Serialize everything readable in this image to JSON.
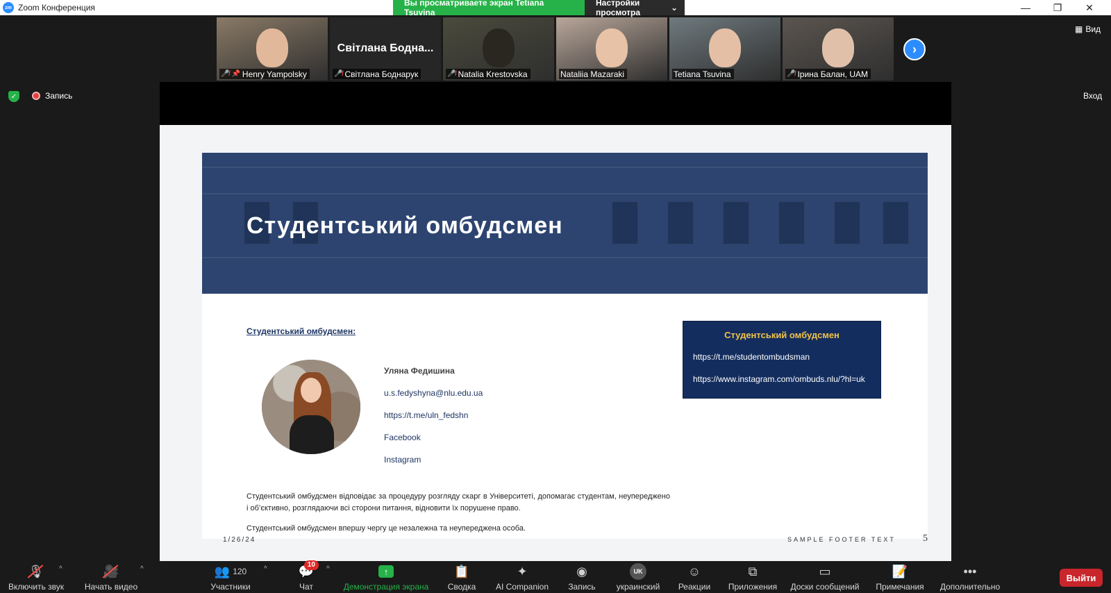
{
  "window": {
    "app_icon_text": "zm",
    "title": "Zoom Конференция",
    "share_notice": "Вы просматриваете экран Tetiana Tsuvina",
    "view_options": "Настройки просмотра",
    "minimize": "—",
    "restore": "❐",
    "close": "✕"
  },
  "participants": [
    {
      "name": "Henry Yampolsky",
      "muted": true,
      "pinned": true,
      "video": true,
      "bg": "#8a7a66",
      "face": "#e2b89a"
    },
    {
      "name": "Світлана Боднарук",
      "display_name": "Світлана  Бодна...",
      "muted": true,
      "video": false
    },
    {
      "name": "Natalia Krestovska",
      "muted": true,
      "video": true,
      "bg": "#4a4a3c",
      "face": "#2a2620"
    },
    {
      "name": "Nataliia Mazaraki",
      "muted": false,
      "video": true,
      "bg": "#b9a79a",
      "face": "#e7c2a6"
    },
    {
      "name": "Tetiana Tsuvina",
      "muted": false,
      "video": true,
      "active": true,
      "bg": "#6f7a7e",
      "face": "#e4bfa6"
    },
    {
      "name": "Ірина Балан, UAM",
      "muted": true,
      "video": true,
      "bg": "#5b5550",
      "face": "#e1c0aa"
    }
  ],
  "strip_next_icon": "chevron-right-icon",
  "view_button": "Вид",
  "status": {
    "recording_label": "Запись",
    "login_label": "Вход"
  },
  "slide": {
    "banner_title": "Студентський омбудсмен",
    "subtitle": "Студентський омбудсмен:",
    "contact": {
      "name": "Уляна Федишина",
      "email": "u.s.fedyshyna@nlu.edu.ua",
      "telegram": "https://t.me/uln_fedshn",
      "facebook": "Facebook",
      "instagram": "Instagram"
    },
    "info_box": {
      "title": "Студентський омбудсмен",
      "link1": "https://t.me/studentombudsman",
      "link2": "https://www.instagram.com/ombuds.nlu/?hl=uk"
    },
    "paragraph1": "Студентський омбудсмен відповідає за процедуру розгляду скарг в Університеті, допомагає студентам, неупереджено і об’єктивно, розглядаючи всі сторони питання, відновити їх порушене право.",
    "paragraph2": "Студентський омбудсмен впершу чергу це незалежна та неупереджена особа.",
    "footer_date": "1/26/24",
    "footer_text": "SAMPLE FOOTER TEXT",
    "page_number": "5"
  },
  "toolbar": {
    "audio": "Включить звук",
    "video": "Начать видео",
    "participants": "Участники",
    "participants_count": "120",
    "chat": "Чат",
    "chat_badge": "10",
    "share": "Демонстрация экрана",
    "summary": "Сводка",
    "ai": "AI Companion",
    "record": "Запись",
    "language": "украинский",
    "language_badge": "UK",
    "reactions": "Реакции",
    "apps": "Приложения",
    "boards": "Доски сообщений",
    "notes": "Примечания",
    "more": "Дополнительно",
    "leave": "Выйти"
  },
  "colors": {
    "share_green": "#26b248",
    "zoom_blue": "#2d8cff",
    "slide_navy": "#132d5e",
    "box_title_gold": "#f0c34a",
    "leave_red": "#c8262b"
  }
}
